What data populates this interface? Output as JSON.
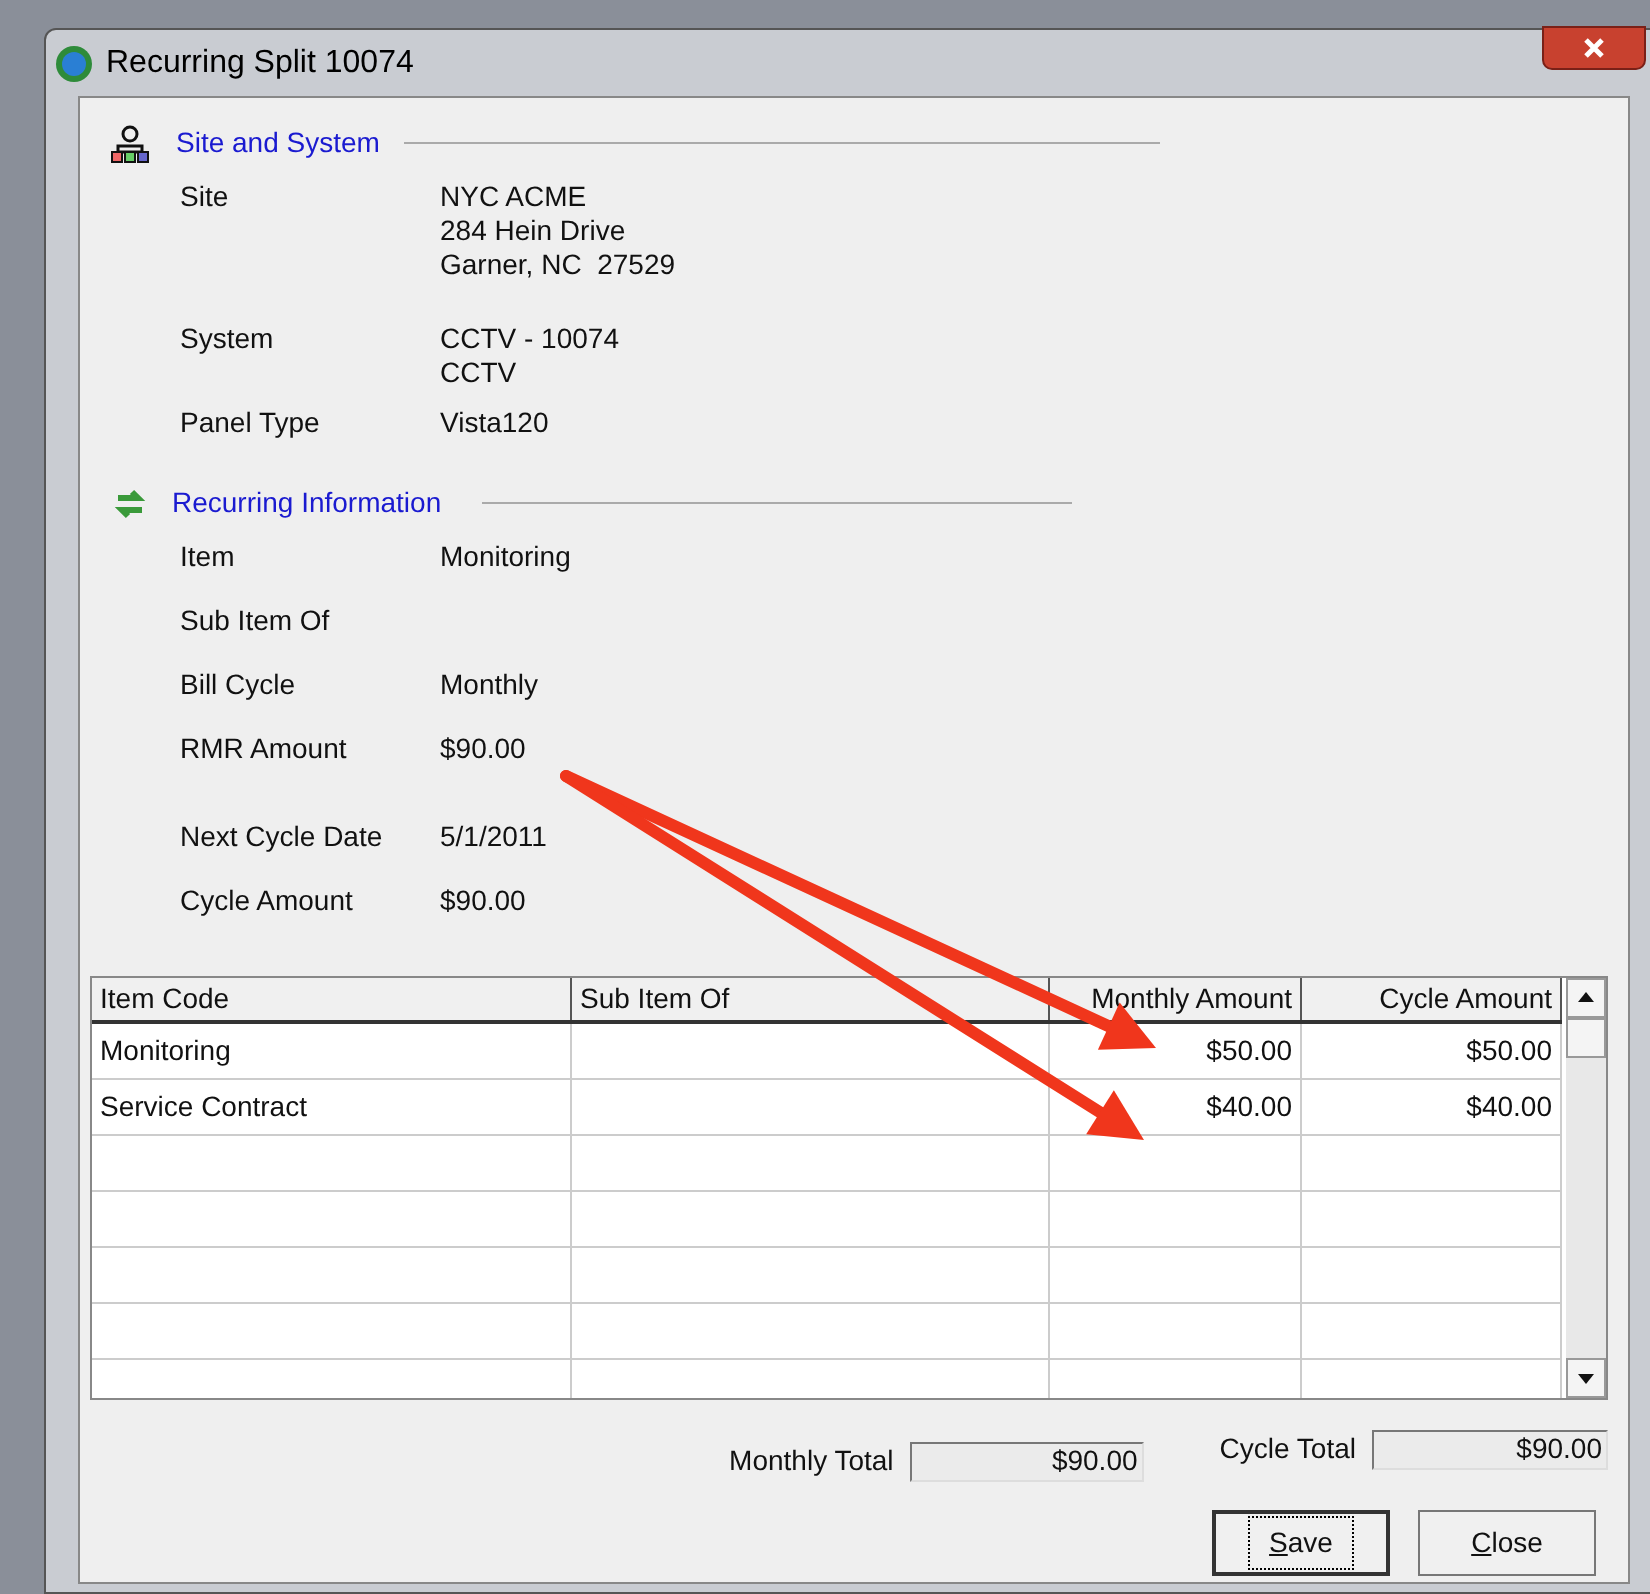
{
  "window": {
    "title": "Recurring Split 10074"
  },
  "sections": [
    {
      "title": "Site and System",
      "fields": [
        {
          "label": "Site",
          "value_lines": [
            "NYC ACME",
            "284 Hein Drive",
            "Garner, NC  27529"
          ]
        },
        {
          "label": "System",
          "value_lines": [
            "CCTV - 10074",
            "CCTV"
          ]
        },
        {
          "label": "Panel Type",
          "value_lines": [
            "Vista120"
          ]
        }
      ]
    },
    {
      "title": "Recurring Information",
      "fields": [
        {
          "label": "Item",
          "value_lines": [
            "Monitoring"
          ]
        },
        {
          "label": "Sub Item Of"
        },
        {
          "label": "Bill Cycle",
          "value_lines": [
            "Monthly"
          ]
        },
        {
          "label": "RMR Amount",
          "value_lines": [
            "$90.00"
          ]
        },
        {
          "label": "Next Cycle Date",
          "value_lines": [
            "5/1/2011"
          ]
        },
        {
          "label": "Cycle Amount",
          "value_lines": [
            "$90.00"
          ]
        }
      ]
    }
  ],
  "table": {
    "columns": [
      {
        "label": "Item Code"
      },
      {
        "label": "Sub Item Of"
      },
      {
        "label": "Monthly Amount"
      },
      {
        "label": "Cycle Amount"
      }
    ],
    "rows": [
      {
        "cells": [
          "Monitoring",
          "",
          "$50.00",
          "$50.00"
        ]
      },
      {
        "cells": [
          "Service Contract",
          "",
          "$40.00",
          "$40.00"
        ]
      }
    ]
  },
  "totals": [
    {
      "label": "Monthly Total",
      "value": "$90.00"
    },
    {
      "label": "Cycle Total",
      "value": "$90.00"
    }
  ],
  "buttons": [
    {
      "label": "Save",
      "focused": true
    },
    {
      "label": "Close",
      "focused": false
    }
  ],
  "annotations": [
    {
      "kind": "arrow"
    },
    {
      "kind": "arrow"
    }
  ]
}
